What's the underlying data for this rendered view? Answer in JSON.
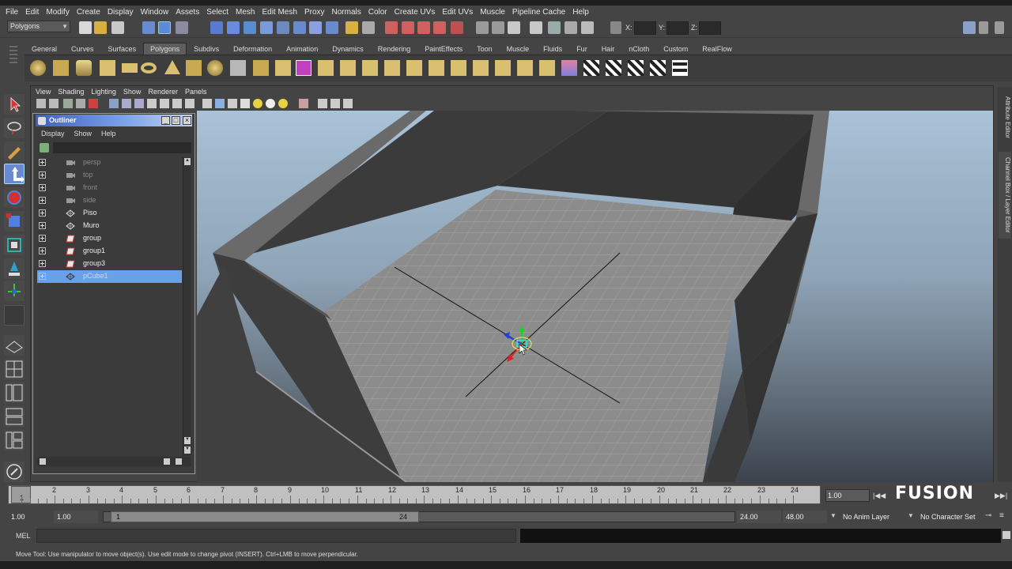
{
  "menubar": {
    "items": [
      "File",
      "Edit",
      "Modify",
      "Create",
      "Display",
      "Window",
      "Assets",
      "Select",
      "Mesh",
      "Edit Mesh",
      "Proxy",
      "Normals",
      "Color",
      "Create UVs",
      "Edit UVs",
      "Muscle",
      "Pipeline Cache",
      "Help"
    ]
  },
  "statusline": {
    "mode": "Polygons",
    "x_label": "X:",
    "y_label": "Y:",
    "z_label": "Z:"
  },
  "shelf": {
    "tabs": [
      "General",
      "Curves",
      "Surfaces",
      "Polygons",
      "Subdivs",
      "Deformation",
      "Animation",
      "Dynamics",
      "Rendering",
      "PaintEffects",
      "Toon",
      "Muscle",
      "Fluids",
      "Fur",
      "Hair",
      "nCloth",
      "Custom",
      "RealFlow"
    ],
    "active_tab": "Polygons"
  },
  "panel": {
    "menu": [
      "View",
      "Shading",
      "Lighting",
      "Show",
      "Renderer",
      "Panels"
    ]
  },
  "outliner": {
    "title": "Outliner",
    "menu": [
      "Display",
      "Show",
      "Help"
    ],
    "items": [
      {
        "label": "persp",
        "dim": true,
        "selected": false,
        "icon": "camera-icon"
      },
      {
        "label": "top",
        "dim": true,
        "selected": false,
        "icon": "camera-icon"
      },
      {
        "label": "front",
        "dim": true,
        "selected": false,
        "icon": "camera-icon"
      },
      {
        "label": "side",
        "dim": true,
        "selected": false,
        "icon": "camera-icon"
      },
      {
        "label": "Piso",
        "dim": false,
        "selected": false,
        "icon": "mesh-icon"
      },
      {
        "label": "Muro",
        "dim": false,
        "selected": false,
        "icon": "mesh-icon"
      },
      {
        "label": "group",
        "dim": false,
        "selected": false,
        "icon": "group-icon"
      },
      {
        "label": "group1",
        "dim": false,
        "selected": false,
        "icon": "group-icon"
      },
      {
        "label": "group3",
        "dim": false,
        "selected": false,
        "icon": "group-icon"
      },
      {
        "label": "pCube1",
        "dim": false,
        "selected": true,
        "icon": "mesh-icon"
      }
    ]
  },
  "right_tabs": {
    "attribute_editor": "Attribute Editor",
    "channel_box": "Channel Box / Layer Editor"
  },
  "timeslider": {
    "ticks": [
      "1",
      "2",
      "3",
      "4",
      "5",
      "6",
      "7",
      "8",
      "9",
      "10",
      "11",
      "12",
      "13",
      "14",
      "15",
      "16",
      "17",
      "18",
      "19",
      "20",
      "21",
      "22",
      "23",
      "24"
    ],
    "current_frame": "1",
    "current_time": "1.00",
    "logo_text": "FUSION"
  },
  "rangeslider": {
    "start_time": "1.00",
    "playback_start": "1.00",
    "range_start_label": "1",
    "range_end_label": "24",
    "playback_end": "24.00",
    "end_time": "48.00",
    "anim_layer": "No Anim Layer",
    "character_set": "No Character Set"
  },
  "cmdline": {
    "label": "MEL"
  },
  "helpline": {
    "text": "Move Tool: Use manipulator to move object(s). Use edit mode to change pivot (INSERT).  Ctrl+LMB to move perpendicular."
  },
  "colors": {
    "selection": "#6aa0e8",
    "outliner_title": "#3f5fc2",
    "manip_x": "#e02020",
    "manip_y": "#20d020",
    "manip_z": "#2040e0"
  }
}
